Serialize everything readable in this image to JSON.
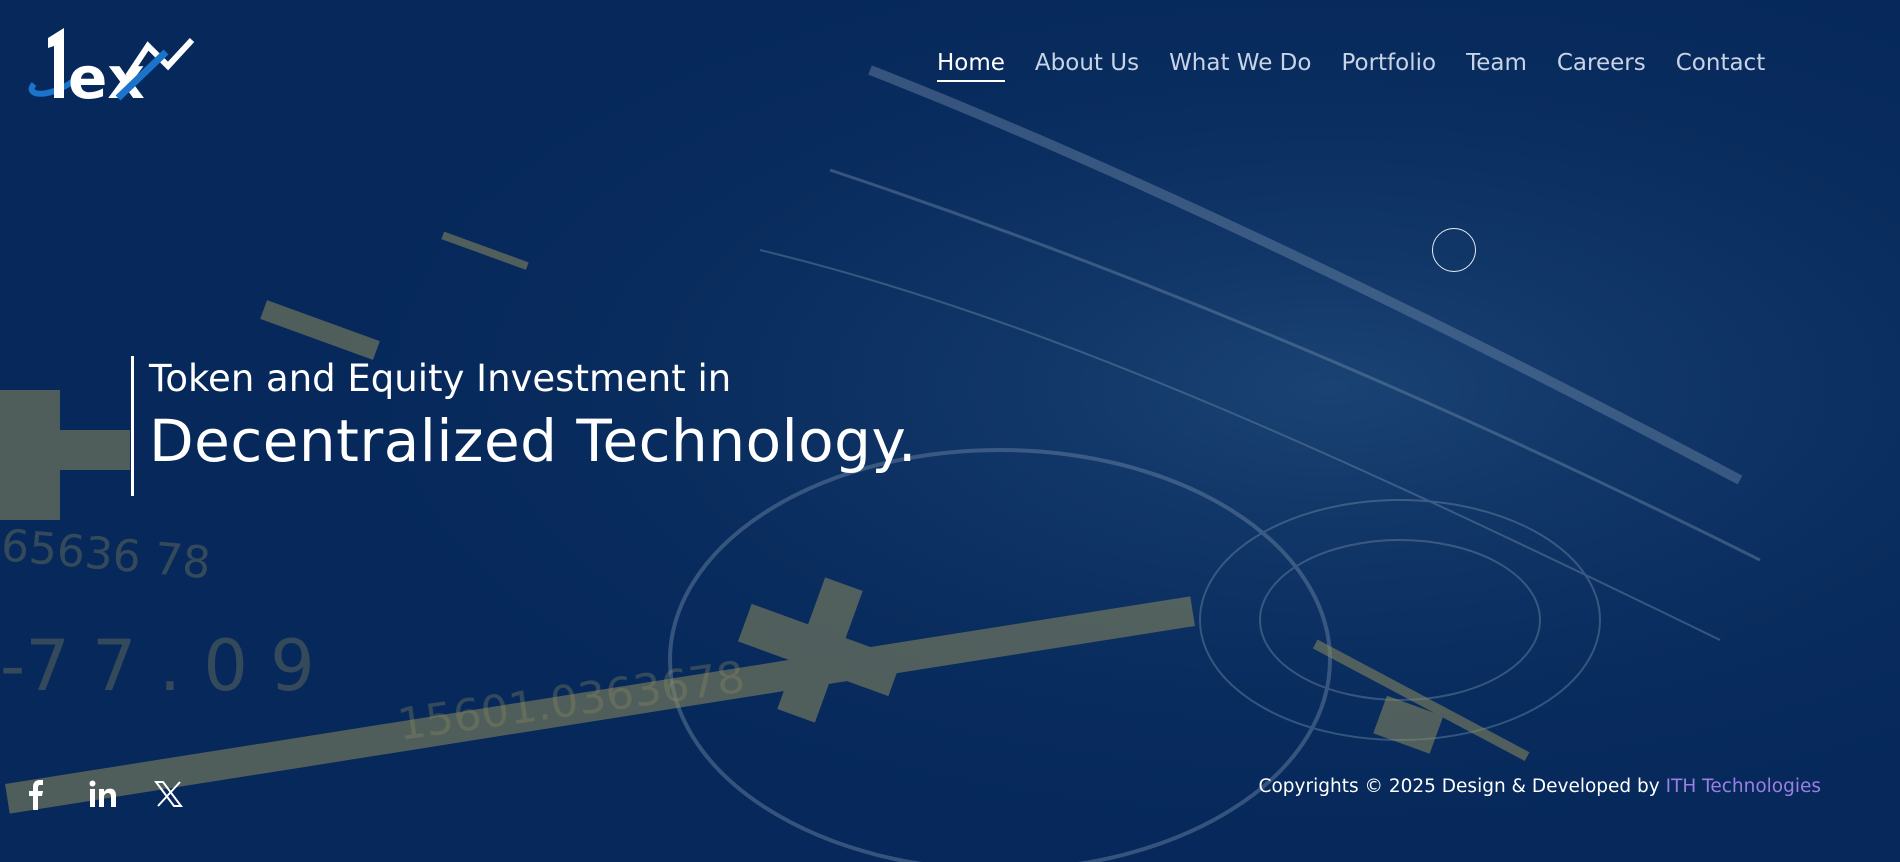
{
  "logo": {
    "alt_name": "1ex"
  },
  "nav": {
    "items": [
      {
        "label": "Home",
        "active": true
      },
      {
        "label": "About Us",
        "active": false
      },
      {
        "label": "What We Do",
        "active": false
      },
      {
        "label": "Portfolio",
        "active": false
      },
      {
        "label": "Team",
        "active": false
      },
      {
        "label": "Careers",
        "active": false
      },
      {
        "label": "Contact",
        "active": false
      }
    ]
  },
  "hero": {
    "subtitle": "Token and Equity Investment in",
    "title": "Decentralized Technology."
  },
  "social": {
    "icons": [
      "facebook-icon",
      "linkedin-icon",
      "x-icon"
    ]
  },
  "footer": {
    "copyright_prefix": "Copyrights © 2025 Design & Developed by ",
    "developer": "ITH Technologies"
  },
  "colors": {
    "background": "#06285a",
    "accent": "#9a7fe6",
    "nav_text": "#c9d3e6",
    "gold_overlay": "#8d8a5e"
  }
}
